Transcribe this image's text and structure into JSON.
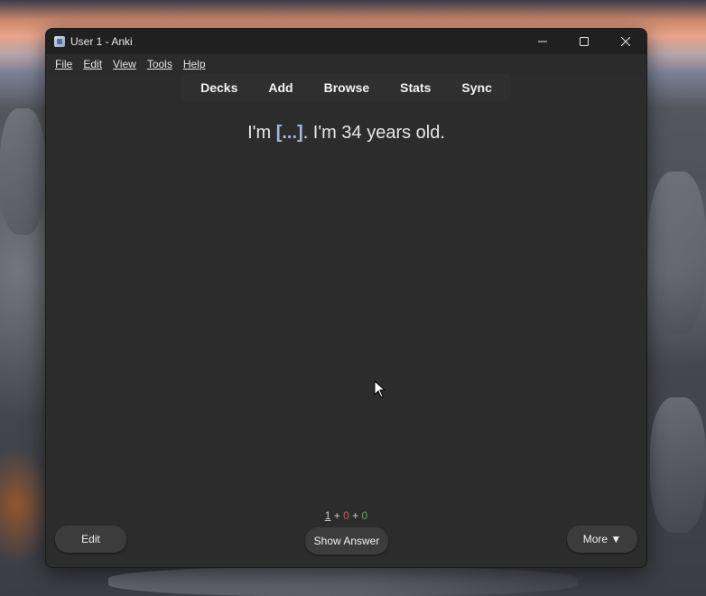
{
  "window": {
    "title": "User 1 - Anki"
  },
  "menu": [
    "File",
    "Edit",
    "View",
    "Tools",
    "Help"
  ],
  "toolbar": {
    "items": [
      "Decks",
      "Add",
      "Browse",
      "Stats",
      "Sync"
    ]
  },
  "card": {
    "prefix": "I'm ",
    "cloze": "[...]",
    "suffix": ". I'm 34 years old."
  },
  "counts": {
    "new": "1",
    "learn": "0",
    "review": "0",
    "separator": " + "
  },
  "buttons": {
    "edit": "Edit",
    "show_answer": "Show Answer",
    "more": "More ▼"
  },
  "colors": {
    "learn": "#d3545f",
    "review": "#4caf50",
    "cloze": "#a7b7d9"
  }
}
